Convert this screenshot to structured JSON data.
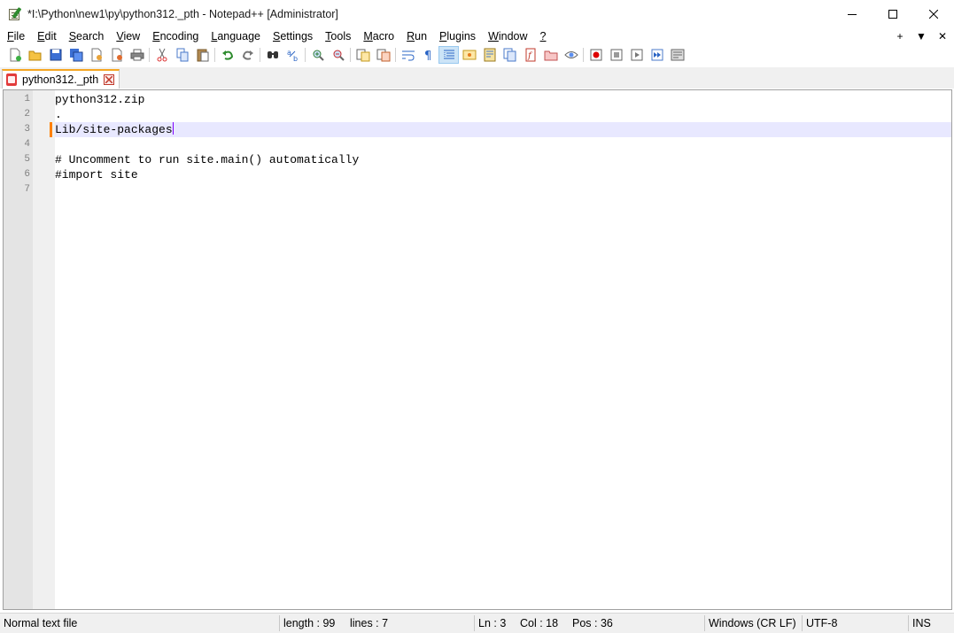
{
  "window": {
    "title": "*I:\\Python\\new1\\py\\python312._pth - Notepad++ [Administrator]",
    "controls": [
      "minimize",
      "maximize",
      "close"
    ]
  },
  "menu": {
    "items": [
      {
        "label": "File",
        "accel": "F",
        "rest": "ile"
      },
      {
        "label": "Edit",
        "accel": "E",
        "rest": "dit"
      },
      {
        "label": "Search",
        "accel": "S",
        "rest": "earch"
      },
      {
        "label": "View",
        "accel": "V",
        "rest": "iew"
      },
      {
        "label": "Encoding",
        "accel": "E",
        "rest": "ncoding"
      },
      {
        "label": "Language",
        "accel": "L",
        "rest": "anguage"
      },
      {
        "label": "Settings",
        "accel": "S",
        "rest": "ettings"
      },
      {
        "label": "Tools",
        "accel": "T",
        "rest": "ools"
      },
      {
        "label": "Macro",
        "accel": "M",
        "rest": "acro"
      },
      {
        "label": "Run",
        "accel": "R",
        "rest": "un"
      },
      {
        "label": "Plugins",
        "accel": "P",
        "rest": "lugins"
      },
      {
        "label": "Window",
        "accel": "W",
        "rest": "indow"
      },
      {
        "label": "?",
        "accel": "?",
        "rest": ""
      }
    ],
    "right": {
      "plus": "+",
      "dropdown": "▼",
      "close": "✕"
    }
  },
  "toolbar": {
    "icons": [
      "new-file-icon",
      "open-file-icon",
      "save-icon",
      "save-all-icon",
      "close-icon",
      "close-all-icon",
      "print-icon",
      "cut-icon",
      "copy-icon",
      "paste-icon",
      "undo-icon",
      "redo-icon",
      "find-icon",
      "replace-icon",
      "zoom-in-icon",
      "zoom-out-icon",
      "sync-vertical-icon",
      "sync-horizontal-icon",
      "word-wrap-icon",
      "show-all-chars-icon",
      "indent-guide-icon",
      "udl-icon",
      "doc-map-icon",
      "doc-list-icon",
      "function-list-icon",
      "folder-workspace-icon",
      "monitoring-icon",
      "record-macro-icon",
      "stop-macro-icon",
      "play-macro-icon",
      "run-macro-multiple-icon",
      "save-macro-icon"
    ]
  },
  "tabs": [
    {
      "label": "python312._pth",
      "modified": true,
      "active": true
    }
  ],
  "editor": {
    "lines": [
      {
        "num": "1",
        "text": "python312.zip"
      },
      {
        "num": "2",
        "text": "."
      },
      {
        "num": "3",
        "text": "Lib/site-packages",
        "current": true
      },
      {
        "num": "4",
        "text": ""
      },
      {
        "num": "5",
        "text": "# Uncomment to run site.main() automatically"
      },
      {
        "num": "6",
        "text": "#import site"
      },
      {
        "num": "7",
        "text": ""
      }
    ],
    "colors": {
      "current_line": "#e8e8ff",
      "caret": "#8000ff",
      "change_marker": "#ff8000"
    }
  },
  "status": {
    "file_type": "Normal text file",
    "length": "length : 99",
    "lines": "lines : 7",
    "ln": "Ln : 3",
    "col": "Col : 18",
    "pos": "Pos : 36",
    "eol": "Windows (CR LF)",
    "encoding": "UTF-8",
    "mode": "INS"
  }
}
